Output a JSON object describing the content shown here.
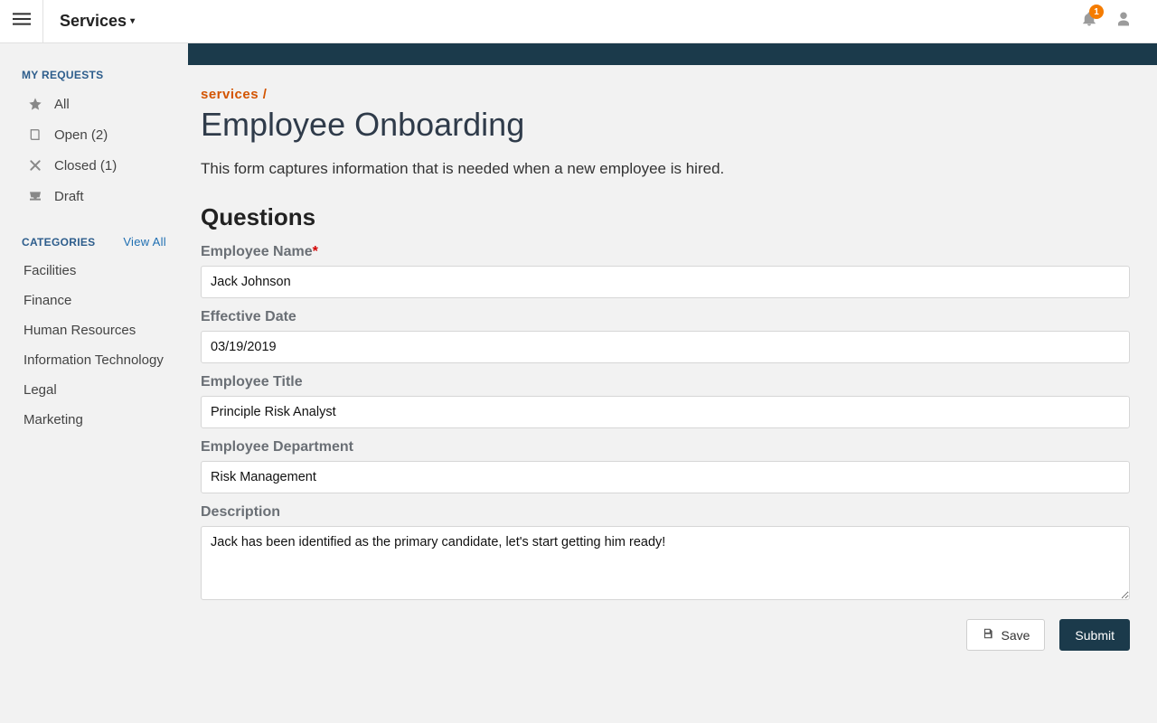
{
  "header": {
    "brand": "Services",
    "notification_count": "1"
  },
  "sidebar": {
    "my_requests_title": "MY REQUESTS",
    "items": [
      {
        "label": "All"
      },
      {
        "label": "Open (2)"
      },
      {
        "label": "Closed (1)"
      },
      {
        "label": "Draft"
      }
    ],
    "categories_title": "CATEGORIES",
    "view_all": "View All",
    "categories": [
      {
        "label": "Facilities"
      },
      {
        "label": "Finance"
      },
      {
        "label": "Human Resources"
      },
      {
        "label": "Information Technology"
      },
      {
        "label": "Legal"
      },
      {
        "label": "Marketing"
      }
    ]
  },
  "page": {
    "breadcrumb": "services /",
    "title": "Employee Onboarding",
    "description": "This form captures information that is needed when a new employee is hired.",
    "questions_heading": "Questions"
  },
  "form": {
    "employee_name": {
      "label": "Employee Name",
      "value": "Jack Johnson",
      "required": true
    },
    "effective_date": {
      "label": "Effective Date",
      "value": "03/19/2019"
    },
    "employee_title": {
      "label": "Employee Title",
      "value": "Principle Risk Analyst"
    },
    "employee_department": {
      "label": "Employee Department",
      "value": "Risk Management"
    },
    "description": {
      "label": "Description",
      "value": "Jack has been identified as the primary candidate, let's start getting him ready!"
    }
  },
  "actions": {
    "save_label": "Save",
    "submit_label": "Submit"
  }
}
